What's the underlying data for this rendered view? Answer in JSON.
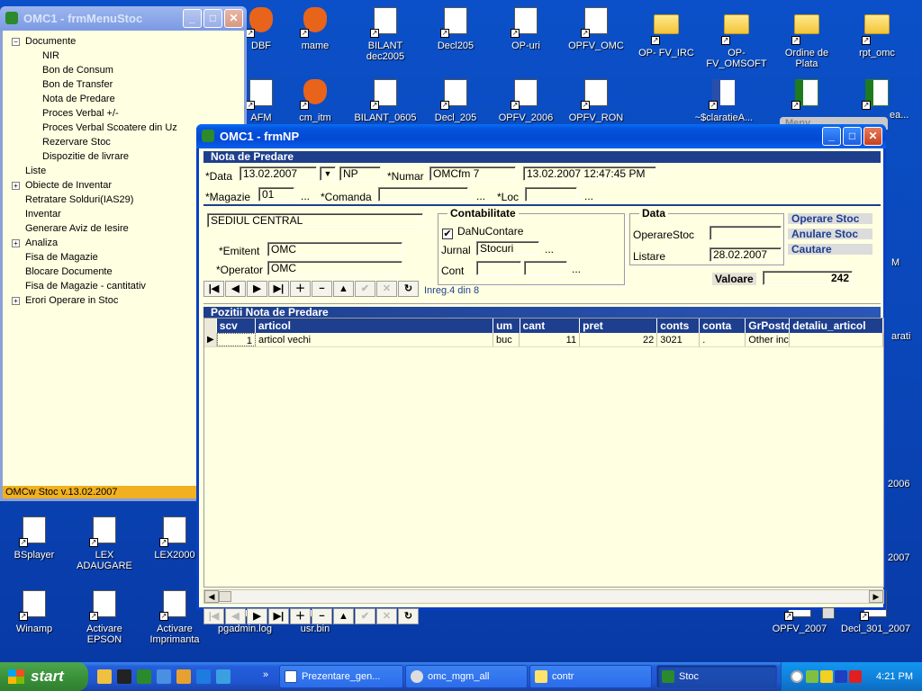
{
  "desktop": {
    "icons": [
      {
        "label": "DBF",
        "kind": "fox"
      },
      {
        "label": "mame",
        "kind": "fox"
      },
      {
        "label": "BILANT dec2005",
        "kind": "page"
      },
      {
        "label": "Decl205",
        "kind": "page"
      },
      {
        "label": "OP-uri",
        "kind": "page"
      },
      {
        "label": "OPFV_OMC",
        "kind": "page"
      },
      {
        "label": "OP- FV_IRC",
        "kind": "folder"
      },
      {
        "label": "OP-FV_OMSOFT",
        "kind": "folder"
      },
      {
        "label": "Ordine de Plata",
        "kind": "folder"
      },
      {
        "label": "rpt_omc",
        "kind": "folder"
      },
      {
        "label": "AFM",
        "kind": "page"
      },
      {
        "label": "cm_itm",
        "kind": "fox"
      },
      {
        "label": "BILANT_0605",
        "kind": "page"
      },
      {
        "label": "Decl_205",
        "kind": "page"
      },
      {
        "label": "OPFV_2006",
        "kind": "page"
      },
      {
        "label": "OPFV_RON",
        "kind": "page"
      },
      {
        "label": "~$claratieA...",
        "kind": "word"
      },
      {
        "label": "",
        "kind": "excel"
      },
      {
        "label": "",
        "kind": "excel"
      },
      {
        "label": "BSplayer",
        "kind": "page"
      },
      {
        "label": "LEX ADAUGARE",
        "kind": "page"
      },
      {
        "label": "LEX2000",
        "kind": "page"
      },
      {
        "label": "Winamp",
        "kind": "page"
      },
      {
        "label": "Activare EPSON",
        "kind": "page"
      },
      {
        "label": "Activare Imprimanta",
        "kind": "page"
      },
      {
        "label": "pgadmin.log",
        "kind": "page"
      },
      {
        "label": "usr.bin",
        "kind": "page"
      },
      {
        "label": "OPFV_2007",
        "kind": "page"
      },
      {
        "label": "Decl_301_2007",
        "kind": "page"
      }
    ],
    "edge_texts": [
      "M",
      "arati",
      "2006",
      "2007",
      "ea...",
      "Meny"
    ]
  },
  "menu_window": {
    "title": "OMC1 - frmMenuStoc",
    "tree": [
      {
        "label": "Documente",
        "level": 0,
        "expander": "−"
      },
      {
        "label": "NIR",
        "level": 1
      },
      {
        "label": "Bon de Consum",
        "level": 1
      },
      {
        "label": "Bon de Transfer",
        "level": 1
      },
      {
        "label": "Nota de Predare",
        "level": 1
      },
      {
        "label": "Proces Verbal +/-",
        "level": 1
      },
      {
        "label": "Proces Verbal Scoatere din Uz",
        "level": 1
      },
      {
        "label": "Rezervare Stoc",
        "level": 1
      },
      {
        "label": "Dispozitie de livrare",
        "level": 1
      },
      {
        "label": "Liste",
        "level": 0
      },
      {
        "label": "Obiecte de Inventar",
        "level": 0,
        "expander": "+"
      },
      {
        "label": "Retratare Solduri(IAS29)",
        "level": 0
      },
      {
        "label": "Inventar",
        "level": 0
      },
      {
        "label": "Generare Aviz de Iesire",
        "level": 0
      },
      {
        "label": "Analiza",
        "level": 0,
        "expander": "+"
      },
      {
        "label": "Fisa de Magazie",
        "level": 0
      },
      {
        "label": "Blocare Documente",
        "level": 0
      },
      {
        "label": "Fisa de Magazie - cantitativ",
        "level": 0
      },
      {
        "label": "Erori Operare in Stoc",
        "level": 0,
        "expander": "+"
      }
    ],
    "status": "OMCw Stoc v.13.02.2007"
  },
  "np_window": {
    "title": "OMC1 - frmNP",
    "header_section": "Nota de Predare",
    "data_label": "*Data",
    "data_value": "13.02.2007",
    "doc_type": "NP",
    "numar_label": "*Numar",
    "numar_value": "OMCfm 7",
    "timestamp": "13.02.2007 12:47:45 PM",
    "magazie_label": "*Magazie",
    "magazie_value": "01",
    "comanda_label": "*Comanda",
    "comanda_value": "",
    "loc_label": "*Loc",
    "loc_value": "",
    "dots": "...",
    "sediu": "SEDIUL CENTRAL",
    "emitent_label": "*Emitent",
    "emitent_value": "OMC",
    "operator_label": "*Operator",
    "operator_value": "OMC",
    "contabilitate": {
      "title": "Contabilitate",
      "checkbox_label": "DaNuContare",
      "checked": true,
      "jurnal_label": "Jurnal",
      "jurnal_value": "Stocuri",
      "cont_label": "Cont",
      "cont_value1": "",
      "cont_value2": ""
    },
    "data_group": {
      "title": "Data",
      "operare_label": "OperareStoc",
      "operare_value": "",
      "listare_label": "Listare",
      "listare_value": "28.02.2007"
    },
    "side_buttons": [
      "Operare Stoc",
      "Anulare Stoc",
      "Cautare"
    ],
    "valoare_label": "Valoare",
    "valoare_value": "242",
    "record_info": "Inreg.4  din 8",
    "positions_section": "Pozitii Nota de Predare",
    "grid": {
      "columns": [
        "scv",
        "articol",
        "um",
        "cant",
        "pret",
        "conts",
        "conta",
        "GrPostc",
        "detaliu_articol"
      ],
      "rows": [
        [
          "1",
          "articol vechi",
          "buc",
          "11",
          "22",
          "3021",
          ".",
          "Other inco",
          ""
        ]
      ]
    }
  },
  "taskbar": {
    "start_label": "start",
    "tasks": [
      "Prezentare_gen...",
      "omc_mgm_all",
      "contr",
      "Stoc"
    ],
    "clock": "4:21 PM"
  },
  "colors": {
    "form_bg": "#ffffe1",
    "section_bar": "#1e3f8e",
    "xp_title": "#0348d2",
    "menu_status": "#f0b020"
  }
}
